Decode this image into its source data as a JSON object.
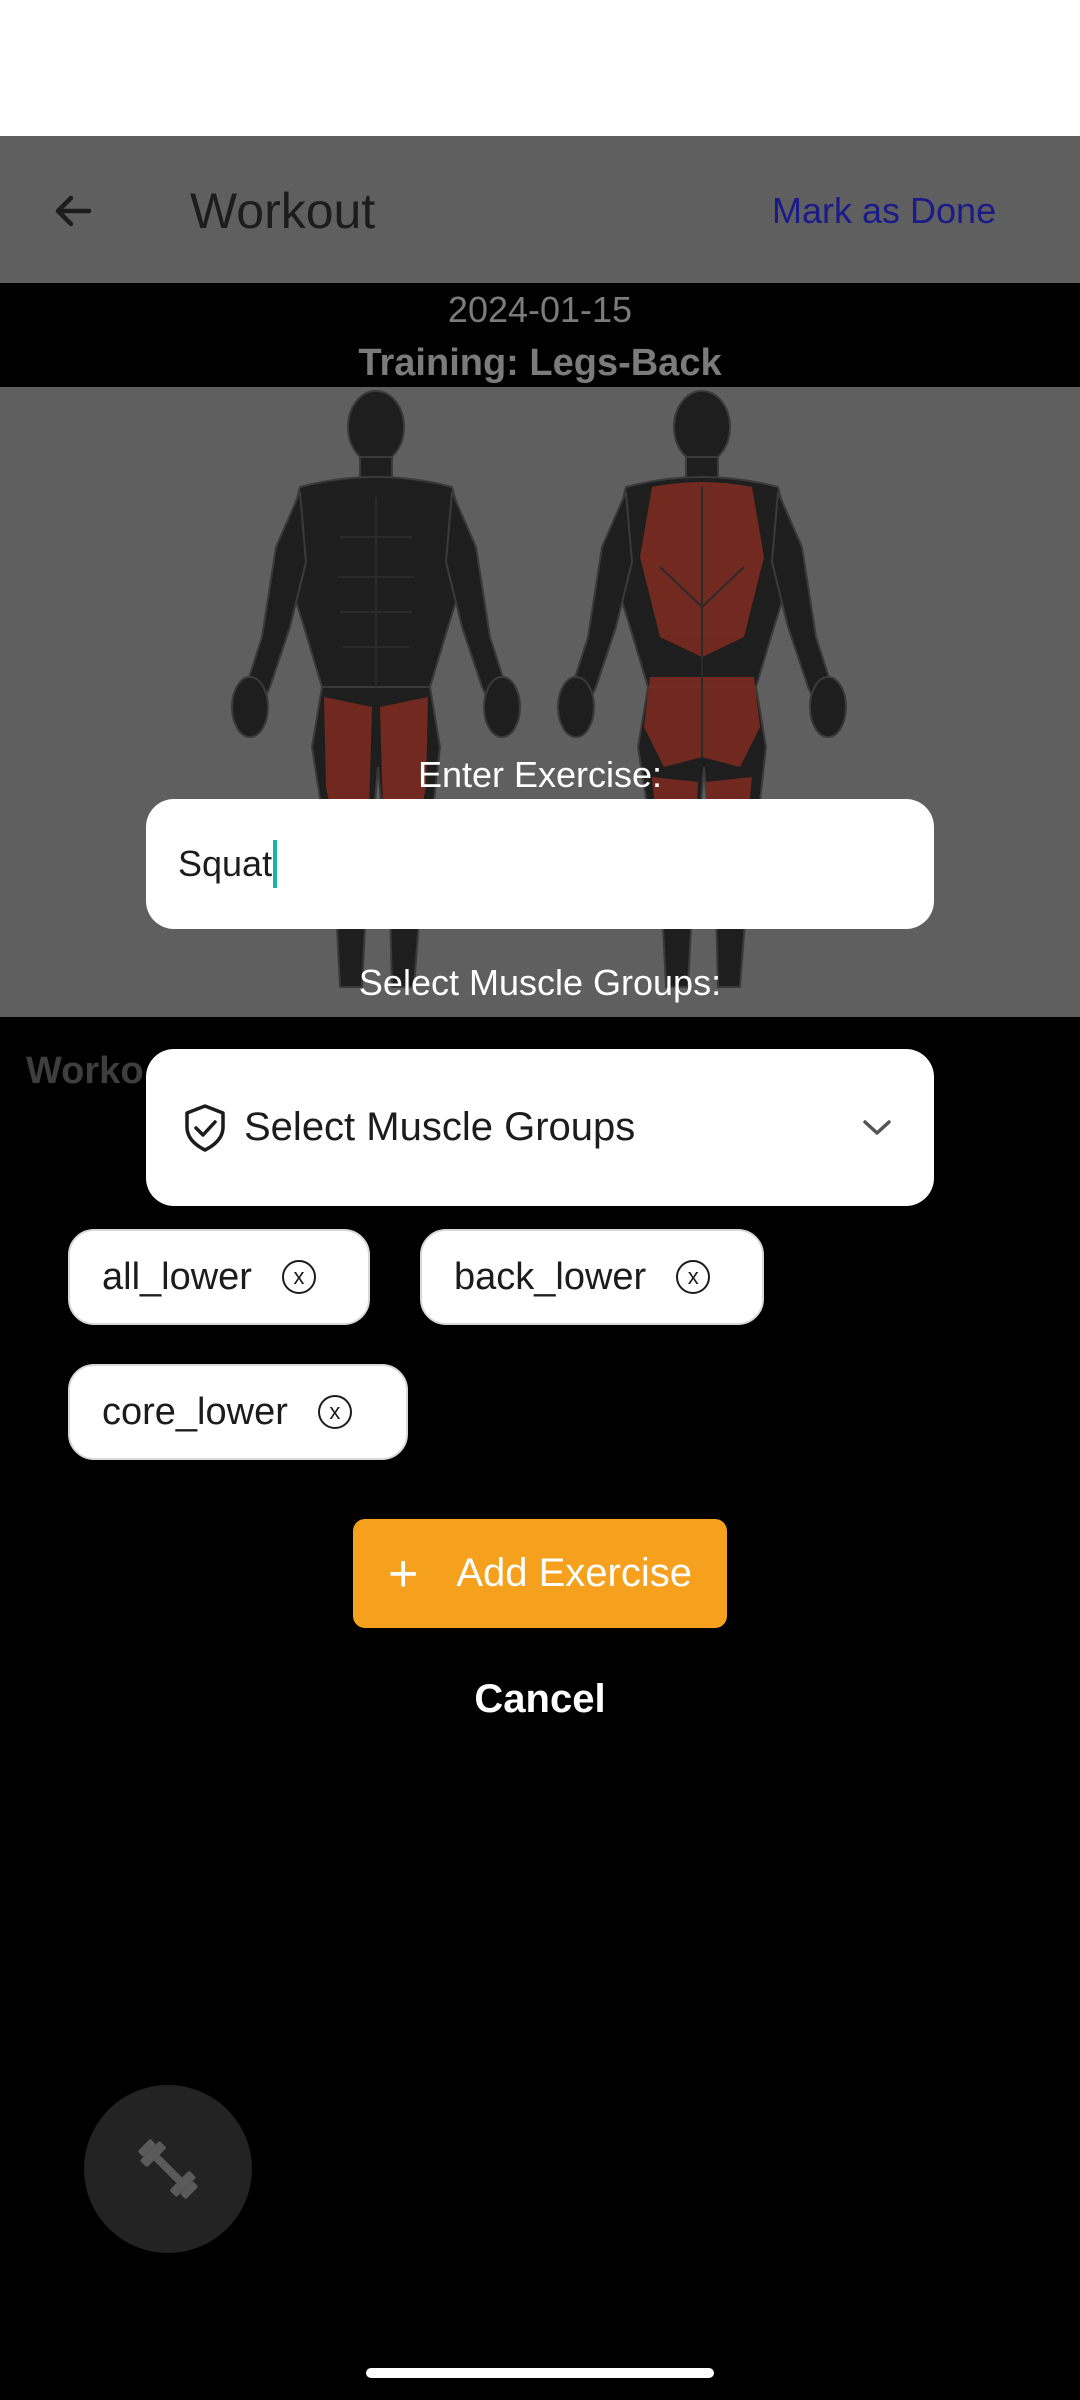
{
  "app_bar": {
    "title": "Workout",
    "back_icon": "arrow-back-icon",
    "action_label": "Mark as Done"
  },
  "session": {
    "date": "2024-01-15",
    "training": "Training: Legs-Back"
  },
  "background_section_label": "Worko",
  "dialog": {
    "exercise_label": "Enter Exercise:",
    "exercise_value": "Squat",
    "muscle_label": "Select Muscle Groups:",
    "muscle_select_placeholder": "Select Muscle Groups",
    "muscle_select_icon": "shield-check-icon",
    "chips": [
      {
        "label": "all_lower"
      },
      {
        "label": "back_lower"
      },
      {
        "label": "core_lower"
      }
    ],
    "add_button_label": "Add Exercise",
    "cancel_label": "Cancel"
  },
  "fab_icon": "dumbbell-icon",
  "colors": {
    "accent": "#f6a11d",
    "action_text": "#1a1a8a",
    "muscle_highlight": "#7a2a20",
    "caret": "#19b5a5"
  }
}
